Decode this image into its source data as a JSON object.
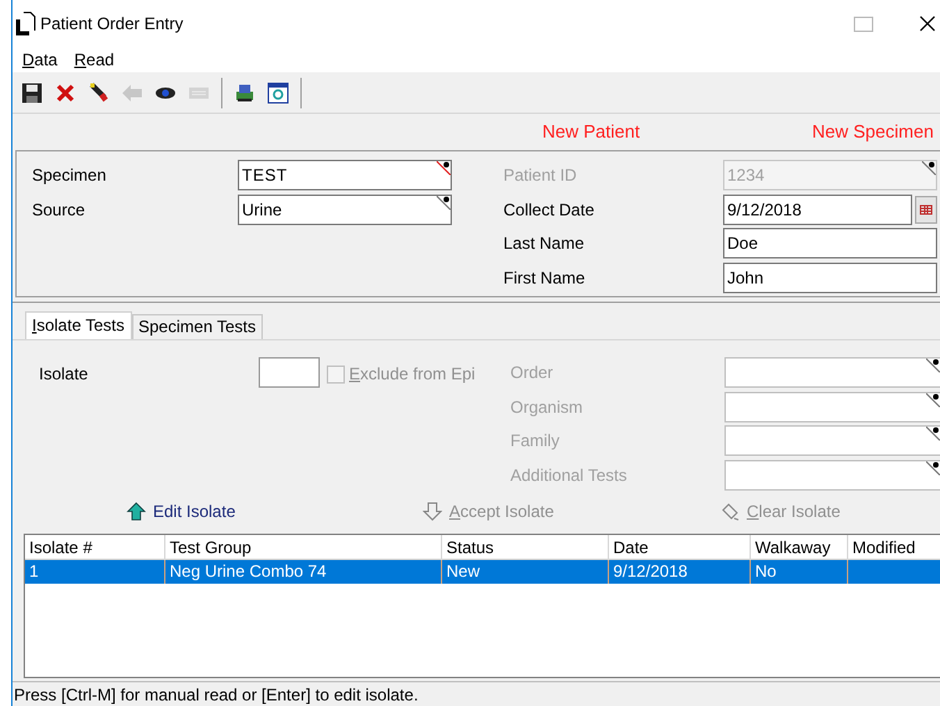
{
  "window": {
    "title": "Patient Order Entry"
  },
  "menu": [
    {
      "label": "Data",
      "underline_first": true
    },
    {
      "label": "Read",
      "underline_first": true
    }
  ],
  "toolbar": [
    [
      {
        "kind": "save",
        "disabled": false
      },
      {
        "kind": "delete",
        "disabled": false
      },
      {
        "kind": "pen",
        "disabled": false
      },
      {
        "kind": "back",
        "disabled": true
      },
      {
        "kind": "eye",
        "disabled": false
      },
      {
        "kind": "keyboard",
        "disabled": true
      }
    ],
    [
      {
        "kind": "printer",
        "disabled": false
      },
      {
        "kind": "preview",
        "disabled": false
      }
    ]
  ],
  "status_labels": [
    "New Patient",
    "New Specimen"
  ],
  "specimen_fields": [
    {
      "label": "Specimen",
      "value": "TEST",
      "required": true
    },
    {
      "label": "Source",
      "value": "Urine",
      "required": false
    }
  ],
  "patient_fields": [
    {
      "label": "Patient ID",
      "value": "1234",
      "kind": "lookup",
      "disabled": true
    },
    {
      "label": "Collect Date",
      "value": "9/12/2018",
      "kind": "date",
      "disabled": false
    },
    {
      "label": "Last Name",
      "value": "Doe",
      "kind": "plain",
      "disabled": false
    },
    {
      "label": "First Name",
      "value": "John",
      "kind": "plain",
      "disabled": false
    }
  ],
  "tabs": [
    {
      "label": "Isolate Tests",
      "selected": true,
      "underline_first": true
    },
    {
      "label": "Specimen Tests",
      "selected": false,
      "underline_first": false
    }
  ],
  "isolate": {
    "label": "Isolate"
  },
  "exclude_checkbox": {
    "label": "Exclude from Epi",
    "checked": false,
    "disabled": true,
    "underline_first": true
  },
  "isolate_fields": [
    {
      "label": "Order",
      "disabled": true
    },
    {
      "label": "Organism",
      "disabled": true
    },
    {
      "label": "Family",
      "disabled": true
    },
    {
      "label": "Additional Tests",
      "disabled": true
    }
  ],
  "actions": [
    {
      "label": "Edit Isolate",
      "kind": "edit",
      "disabled": false,
      "underline_first": false
    },
    {
      "label": "Accept Isolate",
      "kind": "accept",
      "disabled": true,
      "underline_first": true
    },
    {
      "label": "Clear Isolate",
      "kind": "clear",
      "disabled": true,
      "underline_first": true
    }
  ],
  "table": {
    "columns": [
      "Isolate #",
      "Test Group",
      "Status",
      "Date",
      "Walkaway",
      "Modified"
    ],
    "rows": [
      {
        "cells": [
          "1",
          "Neg Urine Combo 74",
          "New",
          "9/12/2018",
          "No",
          ""
        ],
        "selected": true
      }
    ]
  },
  "status_bar": "Press [Ctrl-M] for manual read or [Enter] to edit isolate."
}
